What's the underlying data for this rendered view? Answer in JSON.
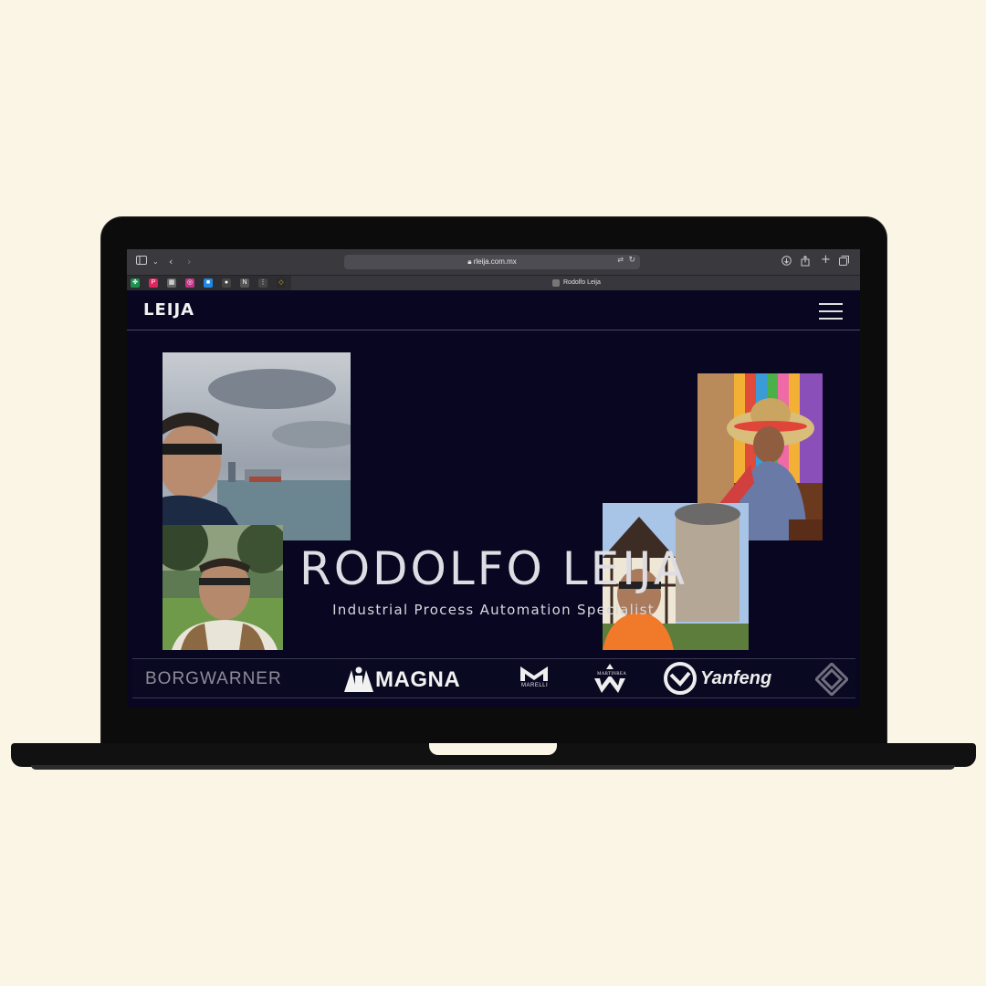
{
  "browser": {
    "url": "rleija.com.mx",
    "tab_title": "Rodolfo Leija",
    "bookmarks": [
      {
        "icon": "clover-icon",
        "color": "#2ecc71"
      },
      {
        "icon": "p-icon",
        "color": "#e0245e",
        "glyph": "P"
      },
      {
        "icon": "qr-icon",
        "color": "#666666",
        "glyph": "▦"
      },
      {
        "icon": "instagram-icon",
        "color": "#c13584",
        "glyph": "◎"
      },
      {
        "icon": "app-icon",
        "color": "#1e88e5",
        "glyph": "■"
      },
      {
        "icon": "github-icon",
        "color": "#444444",
        "glyph": "●"
      },
      {
        "icon": "notion-icon",
        "color": "#555555",
        "glyph": "N"
      },
      {
        "icon": "grid-icon",
        "color": "#444444",
        "glyph": "⋮"
      },
      {
        "icon": "diamond-icon",
        "color": "#f1c40f",
        "glyph": "◇"
      }
    ]
  },
  "site": {
    "brand": "LEIJA",
    "hero_title": "RODOLFO LEIJA",
    "hero_subtitle": "Industrial Process Automation Specialist"
  },
  "clients": [
    {
      "name": "BORGWARNER"
    },
    {
      "name": "MAGNA"
    },
    {
      "name": "MARELLI"
    },
    {
      "name": "MARTINREA"
    },
    {
      "name": "Yanfeng"
    }
  ],
  "colors": {
    "page_bg": "#faf5e4",
    "site_bg": "#080620",
    "text": "#dedde4"
  }
}
